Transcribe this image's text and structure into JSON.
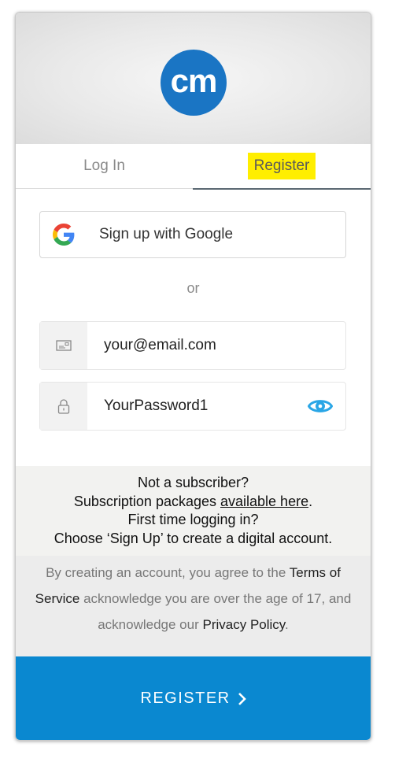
{
  "logo": {
    "text": "cm",
    "color": "#1a75c4"
  },
  "tabs": [
    {
      "label": "Log In",
      "active": false
    },
    {
      "label": "Register",
      "active": true
    }
  ],
  "google_button": {
    "label": "Sign up with Google",
    "icon": "google-icon"
  },
  "divider": {
    "text": "or"
  },
  "email_field": {
    "value": "your@email.com",
    "icon": "email-card-icon"
  },
  "password_field": {
    "value": "YourPassword1",
    "icon": "lock-icon",
    "toggle_icon": "eye-icon"
  },
  "subscriber": {
    "line1": "Not a subscriber?",
    "line2_prefix": "Subscription packages ",
    "line2_link": "available here",
    "line2_suffix": ".",
    "line3": "First time logging in?",
    "line4": "Choose ‘Sign Up’ to create a digital account."
  },
  "terms": {
    "prefix": "By creating an account, you agree to the ",
    "terms_link": "Terms of Service",
    "middle": " acknowledge you are over the age of 17, and acknowledge our ",
    "privacy_link": "Privacy Policy",
    "suffix": "."
  },
  "register_button": {
    "label": "REGISTER",
    "icon": "chevron-right-icon",
    "color": "#0a88d0"
  },
  "colors": {
    "highlight": "#ffee00",
    "eye": "#2aa6e6"
  }
}
